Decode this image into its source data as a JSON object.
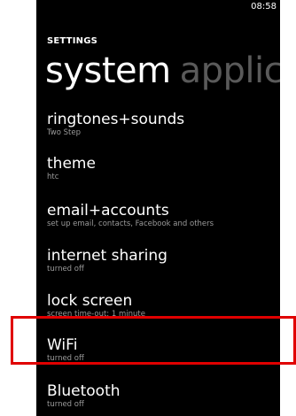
{
  "status": {
    "time": "08:58"
  },
  "header": {
    "app_title": "SETTINGS",
    "pivot_active": "system",
    "pivot_next": "applicat"
  },
  "items": [
    {
      "title": "ringtones+sounds",
      "subtitle": "Two Step"
    },
    {
      "title": "theme",
      "subtitle": "htc"
    },
    {
      "title": "email+accounts",
      "subtitle": "set up email, contacts, Facebook and others"
    },
    {
      "title": "internet sharing",
      "subtitle": "turned off"
    },
    {
      "title": "lock screen",
      "subtitle": "screen time-out: 1 minute"
    },
    {
      "title": "WiFi",
      "subtitle": "turned off"
    },
    {
      "title": "Bluetooth",
      "subtitle": "turned off"
    }
  ],
  "colors": {
    "background": "#000000",
    "highlight_border": "#e00000",
    "inactive_pivot": "#5a5a5a"
  }
}
